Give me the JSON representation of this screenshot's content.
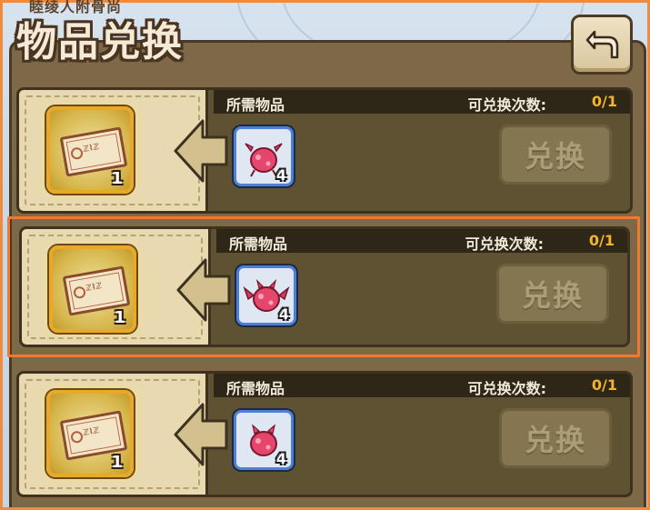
{
  "title": {
    "main": "物品兑换",
    "subtitle": "睦绫人附骨尚"
  },
  "back_icon": "return-arrow-icon",
  "exchanges": [
    {
      "reward_count": "1",
      "reward_icon": "ticket-icon",
      "required_label": "所需物品",
      "required_icon": "pink-crab-creature-icon",
      "required_count": "4",
      "limit_label": "可兑换次数:",
      "limit_value": "0/1",
      "button_label": "兑换"
    },
    {
      "reward_count": "1",
      "reward_icon": "ticket-icon",
      "required_label": "所需物品",
      "required_icon": "pink-winged-creature-icon",
      "required_count": "4",
      "limit_label": "可兑换次数:",
      "limit_value": "0/1",
      "button_label": "兑换"
    },
    {
      "reward_count": "1",
      "reward_icon": "ticket-icon",
      "required_label": "所需物品",
      "required_icon": "pink-round-creature-icon",
      "required_count": "4",
      "limit_label": "可兑换次数:",
      "limit_value": "0/1",
      "button_label": "兑换"
    }
  ],
  "colors": {
    "accent": "#ee7a2f",
    "limit_value": "#f3b52a",
    "slot_border": "#4d7fd6"
  }
}
